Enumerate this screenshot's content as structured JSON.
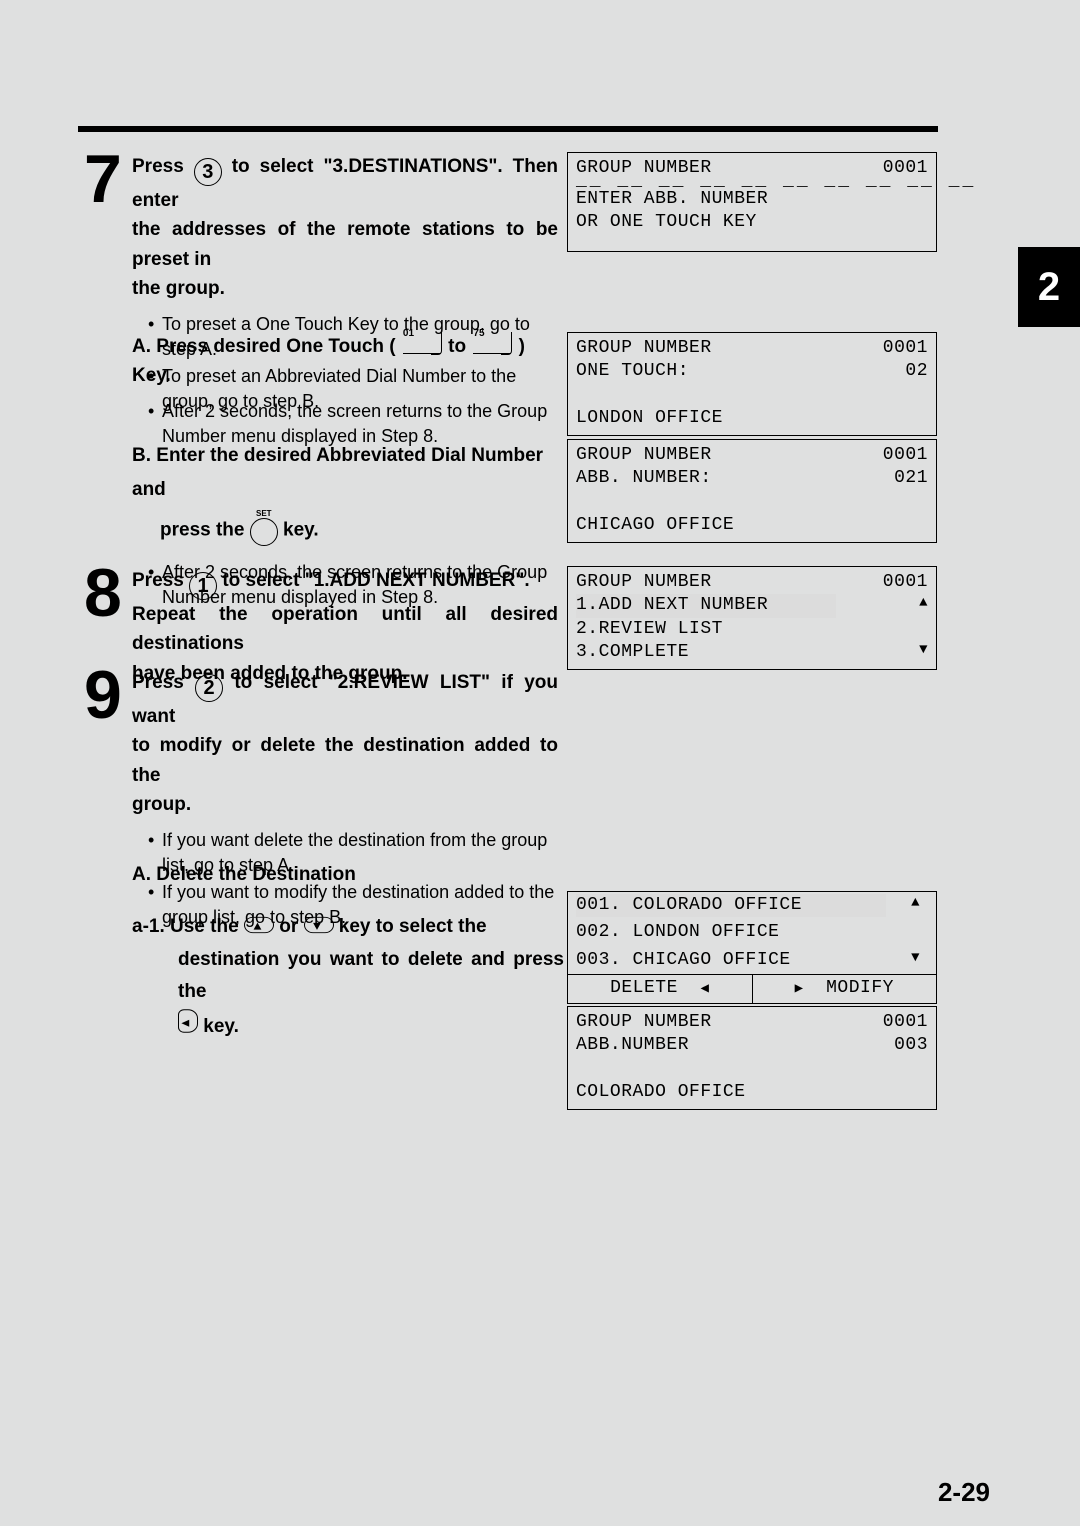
{
  "chapter_tab": "2",
  "page_number": "2-29",
  "step7": {
    "num": "7",
    "button": "3",
    "title_pre": "Press ",
    "title_mid1": " to select \"3.DESTINATIONS\". Then enter",
    "title_line2": "the addresses of the remote stations to be preset in",
    "title_line3": "the group.",
    "bullet1": "To preset a One Touch Key to the group, go to step A.",
    "bullet2": "To preset an Abbreviated Dial Number to the group, go to step B."
  },
  "step7A": {
    "title_pre": "A.  Press desired One Touch ( ",
    "ot_from": "01",
    "title_mid": " to ",
    "ot_to": "75",
    "title_post": " ) Key.",
    "bullet": "After 2 seconds, the screen returns to the Group Number menu displayed in Step 8."
  },
  "step7B": {
    "title_line1": "B.  Enter the desired Abbreviated Dial Number and",
    "title_pre2": "press the ",
    "set_label": "SET",
    "title_post2": " key.",
    "bullet": "After 2 seconds, the screen returns to the Group Number menu displayed in Step 8."
  },
  "step8": {
    "num": "8",
    "button": "1",
    "title_pre": "Press ",
    "title_mid": " to select \"1.ADD NEXT NUMBER\".",
    "title_line2": "Repeat the operation until all desired destinations",
    "title_line3": "have been added to the group."
  },
  "step9": {
    "num": "9",
    "button": "2",
    "title_pre": "Press ",
    "title_mid": " to select \"2.REVIEW LIST\" if you want",
    "title_line2": "to modify or delete the destination added to the",
    "title_line3": "group.",
    "bullet1": "If you want delete the destination from the group list, go to step A.",
    "bullet2": "If you want to modify the destination added to the group list, go to step B."
  },
  "step9A": {
    "title": "A.  Delete the Destination",
    "a1_pre": "a-1.  Use the ",
    "a1_mid": " or ",
    "a1_post": " key to select the",
    "a1_line2": "destination you want to delete and press the",
    "a1_line3": " key."
  },
  "lcd1": {
    "l1a": "GROUP NUMBER",
    "l1b": "0001",
    "dashes": "__ __ __ __ __ __ __ __ __ __",
    "l2": "ENTER ABB. NUMBER",
    "l3": "OR ONE TOUCH KEY"
  },
  "lcd2": {
    "l1a": "GROUP NUMBER",
    "l1b": "0001",
    "l2a": "ONE TOUCH:",
    "l2b": "02",
    "l4": "LONDON OFFICE"
  },
  "lcd3": {
    "l1a": "GROUP NUMBER",
    "l1b": "0001",
    "l2a": "ABB. NUMBER:",
    "l2b": "021",
    "l4": "CHICAGO OFFICE"
  },
  "lcd4": {
    "l1a": "GROUP NUMBER",
    "l1b": "0001",
    "l2": "1.ADD NEXT NUMBER",
    "l3": "2.REVIEW LIST",
    "l4": "3.COMPLETE"
  },
  "lcd5": {
    "r1": "001. COLORADO OFFICE",
    "r2": "002. LONDON OFFICE",
    "r3": "003. CHICAGO OFFICE",
    "f1": "DELETE",
    "f2": "MODIFY"
  },
  "lcd6": {
    "l1a": "GROUP NUMBER",
    "l1b": "0001",
    "l2a": "ABB.NUMBER",
    "l2b": "003",
    "l4": "COLORADO OFFICE"
  }
}
